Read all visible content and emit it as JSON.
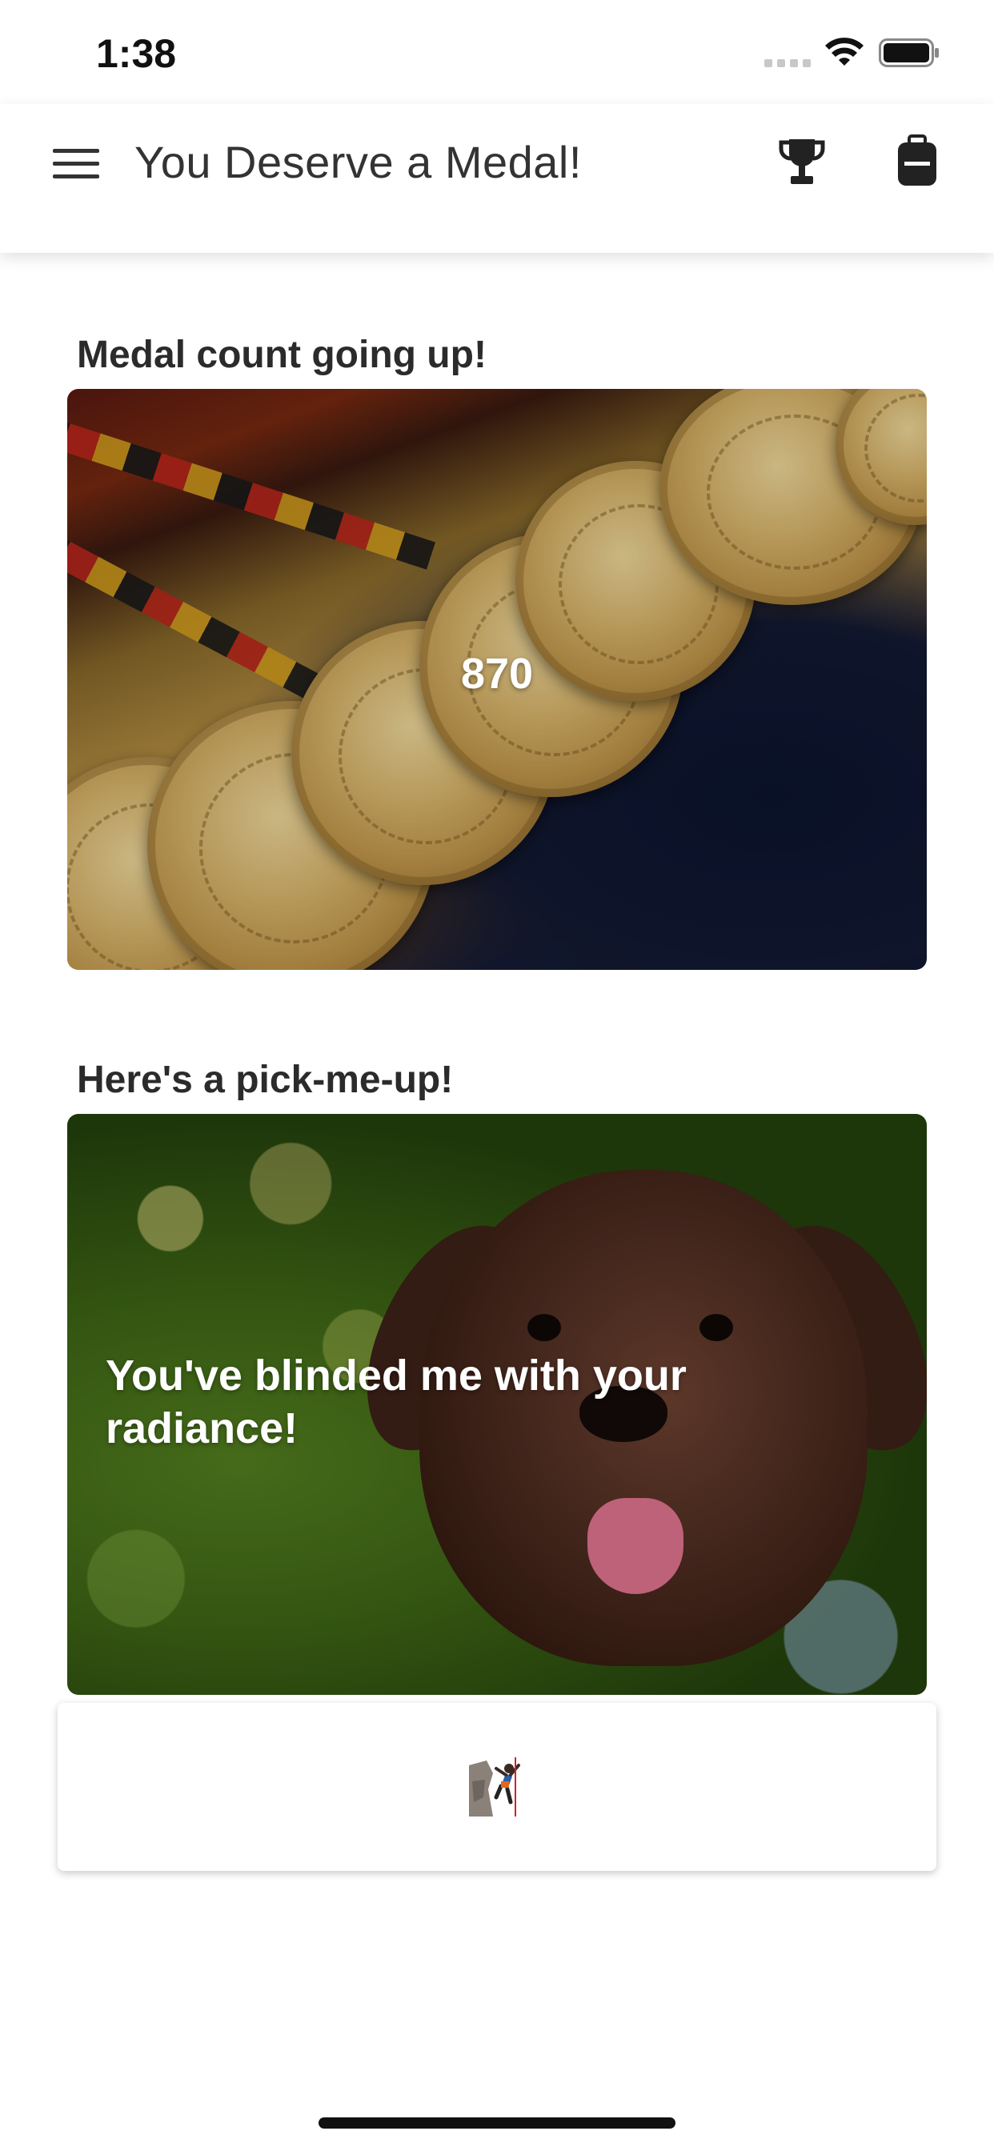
{
  "status_bar": {
    "time": "1:38",
    "signal_icon": "cellular-signal-icon",
    "wifi_icon": "wifi-icon",
    "battery_icon": "battery-full-icon"
  },
  "app_bar": {
    "title": "You Deserve a Medal!",
    "menu_icon": "hamburger-menu-icon",
    "actions": [
      "trophy-icon",
      "backpack-icon"
    ]
  },
  "medals_section": {
    "heading": "Medal count going up!",
    "count": "870",
    "image": "gold-medals-photo"
  },
  "pickmeup_section": {
    "heading": "Here's a pick-me-up!",
    "message": "You've blinded me with your radiance!",
    "image": "puppy-photo"
  },
  "bottom_card": {
    "icon": "rock-climber-icon"
  },
  "colors": {
    "text": "#2b2b2b",
    "background": "#ffffff",
    "overlay_text": "#ffffff"
  }
}
